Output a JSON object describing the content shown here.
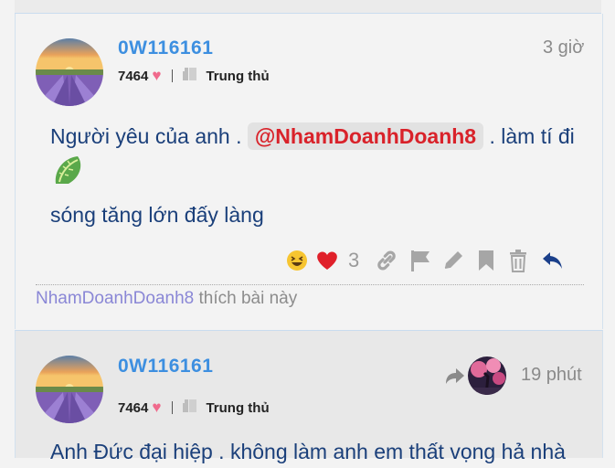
{
  "posts": [
    {
      "username": "0W116161",
      "likes": "7464",
      "rank": "Trung thủ",
      "time": "3 giờ",
      "text_before": "Người yêu của anh .",
      "mention": "@NhamDoanhDoanh8",
      "text_after_line1": ". làm tí đi",
      "text_line2": "sóng tăng lớn đấy làng",
      "reaction_count": "3",
      "liked_by_user": "NhamDoanhDoanh8",
      "liked_by_suffix": "thích bài này"
    },
    {
      "username": "0W116161",
      "likes": "7464",
      "rank": "Trung thủ",
      "time": "19 phút",
      "text_line1": "Anh Đức đại hiệp . không làm anh em thất vọng hả nhà"
    }
  ],
  "colors": {
    "username": "#3d8fe0",
    "content": "#1a3f7a",
    "mention_text": "#d9222a",
    "heart": "#f06a8c",
    "reply_arrow": "#1a3f8a"
  },
  "icons": [
    "heart-icon",
    "rank-icon",
    "laughing-emoji-icon",
    "red-heart-icon",
    "link-icon",
    "flag-icon",
    "pencil-icon",
    "bookmark-icon",
    "trash-icon",
    "reply-icon",
    "lettuce-emoji-icon",
    "reply-arrow-icon"
  ]
}
